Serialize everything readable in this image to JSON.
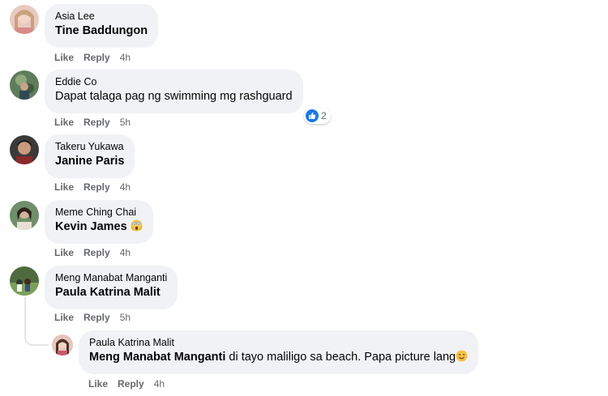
{
  "comments": [
    {
      "author": "Asia Lee",
      "mention": "Tine Baddungon",
      "text": "",
      "like": "Like",
      "reply": "Reply",
      "time": "4h"
    },
    {
      "author": "Eddie Co",
      "mention": "",
      "text": "Dapat talaga pag ng swimming mg rashguard",
      "like": "Like",
      "reply": "Reply",
      "time": "5h",
      "reaction_count": "2"
    },
    {
      "author": "Takeru Yukawa",
      "mention": "Janine Paris",
      "text": "",
      "like": "Like",
      "reply": "Reply",
      "time": "4h"
    },
    {
      "author": "Meme Ching Chai",
      "mention": "Kevin James",
      "text": "",
      "like": "Like",
      "reply": "Reply",
      "time": "4h",
      "emoji": "scream-emoji-icon"
    },
    {
      "author": "Meng Manabat Manganti",
      "mention": "Paula Katrina Malit",
      "text": "",
      "like": "Like",
      "reply": "Reply",
      "time": "5h"
    }
  ],
  "reply": {
    "author": "Paula Katrina Malit",
    "mention": "Meng Manabat Manganti",
    "text": " di tayo maliligo sa beach. Papa picture lang",
    "like": "Like",
    "reply": "Reply",
    "time": "4h",
    "emoji": "smile-emoji-icon"
  },
  "colors": {
    "bubble": "#f0f2f5",
    "meta_text": "#65676b",
    "like_blue": "#1877f2"
  }
}
